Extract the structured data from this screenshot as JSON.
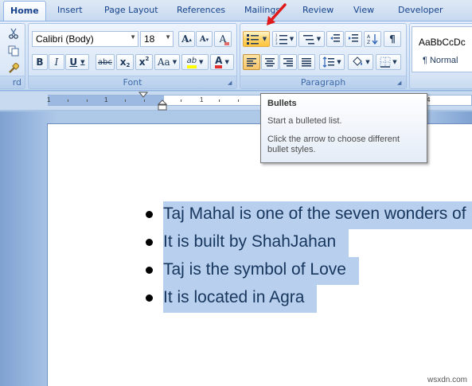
{
  "tabs": [
    {
      "label": "Home",
      "active": true
    },
    {
      "label": "Insert"
    },
    {
      "label": "Page Layout"
    },
    {
      "label": "References"
    },
    {
      "label": "Mailings"
    },
    {
      "label": "Review"
    },
    {
      "label": "View"
    },
    {
      "label": "Developer"
    }
  ],
  "clipboard": {
    "label": "rd"
  },
  "font": {
    "label": "Font",
    "name": "Calibri (Body)",
    "size": "18",
    "grow": "A",
    "shrink": "A",
    "clear": "A",
    "bold": "B",
    "italic": "I",
    "underline": "U",
    "strike": "abc",
    "subscript": "x",
    "superscript": "x",
    "change_case": "Aa",
    "highlight": "ab",
    "font_color": "A"
  },
  "paragraph": {
    "label": "Paragraph",
    "pilcrow": "¶"
  },
  "styles": {
    "preview": "AaBbCcDc",
    "name": "¶ Normal"
  },
  "ruler": {
    "numbers": [
      "1",
      "1",
      "1",
      "2",
      "3",
      "4"
    ]
  },
  "tooltip": {
    "title": "Bullets",
    "line1": "Start a bulleted list.",
    "line2": "Click the arrow to choose different",
    "line3": "bullet styles."
  },
  "document": {
    "items": [
      "Taj Mahal is  one of the seven wonders of",
      "It is built by ShahJahan",
      "Taj is the symbol of Love",
      "It is located in Agra"
    ]
  },
  "watermark": "wsxdn.com",
  "colors": {
    "accent": "#ffc43a",
    "selection": "#b8cfee",
    "text": "#17365d"
  }
}
